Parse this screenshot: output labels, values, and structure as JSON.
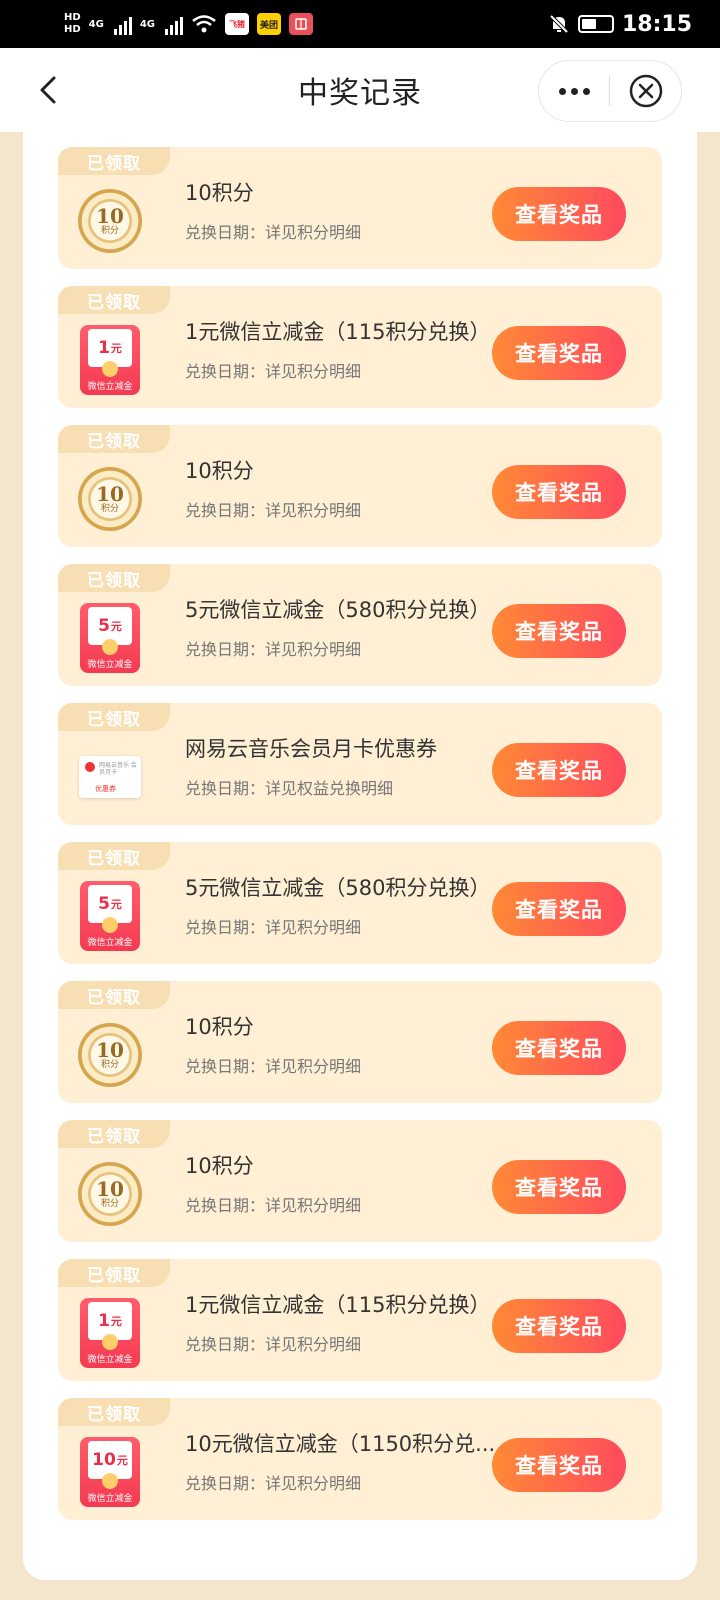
{
  "status_bar": {
    "hd1": "HD",
    "hd2": "HD",
    "net1": "4G",
    "net2": "4G",
    "app1": "飞猪",
    "app2": "美团",
    "time": "18:15"
  },
  "header": {
    "title": "中奖记录"
  },
  "records": [
    {
      "tag": "已领取",
      "icon": "coin",
      "icon_value": "10",
      "icon_unit": "积分",
      "title": "10积分",
      "date": "兑换日期：详见积分明细",
      "button": "查看奖品"
    },
    {
      "tag": "已领取",
      "icon": "envelope",
      "icon_value": "1",
      "icon_unit": "元",
      "icon_label": "微信立减金",
      "title": "1元微信立减金（115积分兑换）",
      "date": "兑换日期：详见积分明细",
      "button": "查看奖品"
    },
    {
      "tag": "已领取",
      "icon": "coin",
      "icon_value": "10",
      "icon_unit": "积分",
      "title": "10积分",
      "date": "兑换日期：详见积分明细",
      "button": "查看奖品"
    },
    {
      "tag": "已领取",
      "icon": "envelope",
      "icon_value": "5",
      "icon_unit": "元",
      "icon_label": "微信立减金",
      "title": "5元微信立减金（580积分兑换）",
      "date": "兑换日期：详见积分明细",
      "button": "查看奖品"
    },
    {
      "tag": "已领取",
      "icon": "voucher",
      "icon_top": "网易云音乐 会员月卡",
      "icon_label": "优惠券",
      "title": "网易云音乐会员月卡优惠券",
      "date": "兑换日期：详见权益兑换明细",
      "button": "查看奖品"
    },
    {
      "tag": "已领取",
      "icon": "envelope",
      "icon_value": "5",
      "icon_unit": "元",
      "icon_label": "微信立减金",
      "title": "5元微信立减金（580积分兑换）",
      "date": "兑换日期：详见积分明细",
      "button": "查看奖品"
    },
    {
      "tag": "已领取",
      "icon": "coin",
      "icon_value": "10",
      "icon_unit": "积分",
      "title": "10积分",
      "date": "兑换日期：详见积分明细",
      "button": "查看奖品"
    },
    {
      "tag": "已领取",
      "icon": "coin",
      "icon_value": "10",
      "icon_unit": "积分",
      "title": "10积分",
      "date": "兑换日期：详见积分明细",
      "button": "查看奖品"
    },
    {
      "tag": "已领取",
      "icon": "envelope",
      "icon_value": "1",
      "icon_unit": "元",
      "icon_label": "微信立减金",
      "title": "1元微信立减金（115积分兑换）",
      "date": "兑换日期：详见积分明细",
      "button": "查看奖品"
    },
    {
      "tag": "已领取",
      "icon": "envelope",
      "icon_value": "10",
      "icon_unit": "元",
      "icon_label": "微信立减金",
      "title": "10元微信立减金（1150积分兑...",
      "date": "兑换日期：详见积分明细",
      "button": "查看奖品"
    }
  ]
}
